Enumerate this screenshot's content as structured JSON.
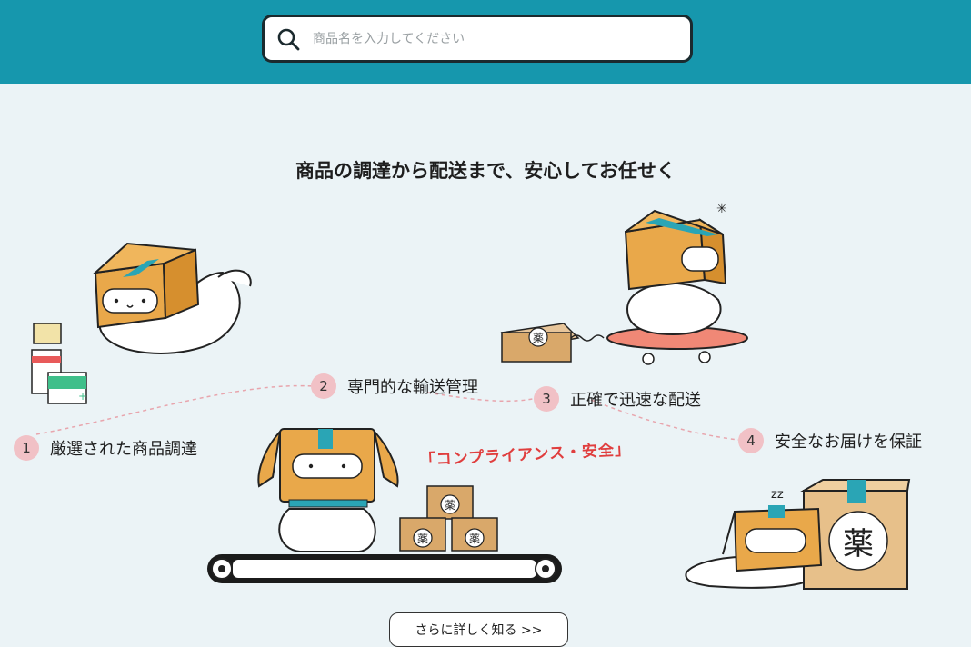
{
  "search": {
    "placeholder": "商品名を入力してください"
  },
  "main": {
    "title": "商品の調達から配送まで、安心してお任せく",
    "steps": [
      {
        "num": "1",
        "label": "厳選された商品調達"
      },
      {
        "num": "2",
        "label": "専門的な輸送管理"
      },
      {
        "num": "3",
        "label": "正確で迅速な配送"
      },
      {
        "num": "4",
        "label": "安全なお届けを保証"
      }
    ],
    "compliance": "｢コンプライアンス・安全｣",
    "box_label": "薬",
    "zz": "zz",
    "more_button": "さらに詳しく知る >>"
  },
  "colors": {
    "header": "#1697ad",
    "background": "#ebf3f6",
    "step_badge": "#f1c1c6",
    "accent_red": "#e03e3e",
    "box": "#e9a84a",
    "tape": "#2aa5b5"
  }
}
